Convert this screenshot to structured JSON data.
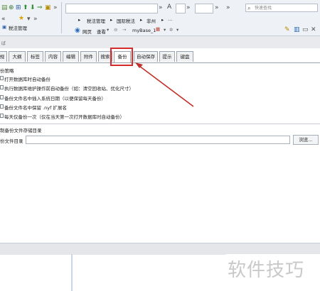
{
  "toolbar": {
    "search_placeholder": "快速查找",
    "breadcrumbs": [
      "税法管理",
      "国际税法",
      "非州"
    ],
    "nav_page_label": "网页",
    "nav_view_label": "查看",
    "db_name": "myBase_1",
    "left_panel_title": "税法管理",
    "arrows": "»"
  },
  "tabs": [
    "规",
    "大纲",
    "标签",
    "内容",
    "编辑",
    "附件",
    "搜索",
    "备份",
    "自动保存",
    "提示",
    "键盘"
  ],
  "active_tab_index": 7,
  "backup": {
    "section_title": "份策略",
    "options": [
      {
        "label": "打开数据库时自动备份",
        "checked": false
      },
      {
        "label": "执行数据库维护操作前自动备份（如：清空回收站、优化尺寸）",
        "checked": false
      },
      {
        "label": "备份文件名中插入系统日期（以便保留每天备份）",
        "checked": false
      },
      {
        "label": "备份文件名中保留 .nyf 扩展名",
        "checked": false
      },
      {
        "label": "每天仅备份一次（仅在当天第一次打开数据库时自动备份）",
        "checked": false
      }
    ],
    "dir_section_title": "制备份文件存储目录",
    "dir_label": "份文件目录",
    "dir_value": "",
    "browse_label": "浏览..."
  },
  "watermark": "软件技巧",
  "colors": {
    "highlight": "#d42a2a",
    "arrow": "#c0302a",
    "watermark": "#c9c9c9"
  }
}
